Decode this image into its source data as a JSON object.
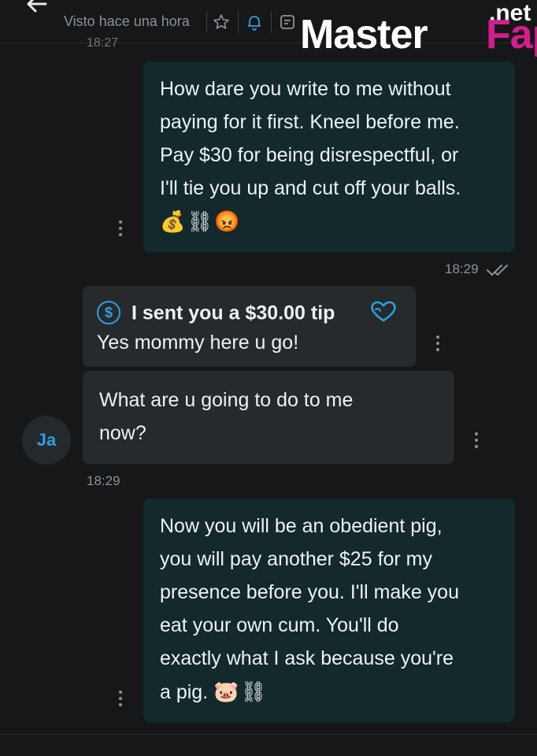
{
  "header": {
    "status": "Visto hace una hora",
    "top_timestamp": "18:27"
  },
  "watermark": {
    "master": "Master",
    "fap": "Fap",
    "net": ".net"
  },
  "messages": [
    {
      "lines": [
        "How dare you write to me without",
        "paying for it first. Kneel before me.",
        "Pay $30 for being disrespectful, or",
        "I'll tie you up and cut off your balls."
      ],
      "emoji": "💰⛓😡",
      "time": "18:29"
    },
    {
      "tip_title": "I sent you a $30.00 tip",
      "text": "Yes mommy here u go!"
    },
    {
      "lines": [
        "What are u going to do to me",
        "now?"
      ],
      "time": "18:29",
      "avatar": "Ja"
    },
    {
      "lines": [
        "Now you will be an obedient pig,",
        "you will pay another $25 for my",
        "presence before you. I'll make you",
        "eat your own cum. You'll do",
        "exactly what I ask because you're",
        "a pig."
      ],
      "emoji": "🐷⛓"
    }
  ],
  "colors": {
    "background": "#161718",
    "sent_bubble": "#13292b",
    "received_bubble": "#272a2c",
    "accent": "#2aa1e0",
    "watermark_pink": "#d51c8f"
  }
}
